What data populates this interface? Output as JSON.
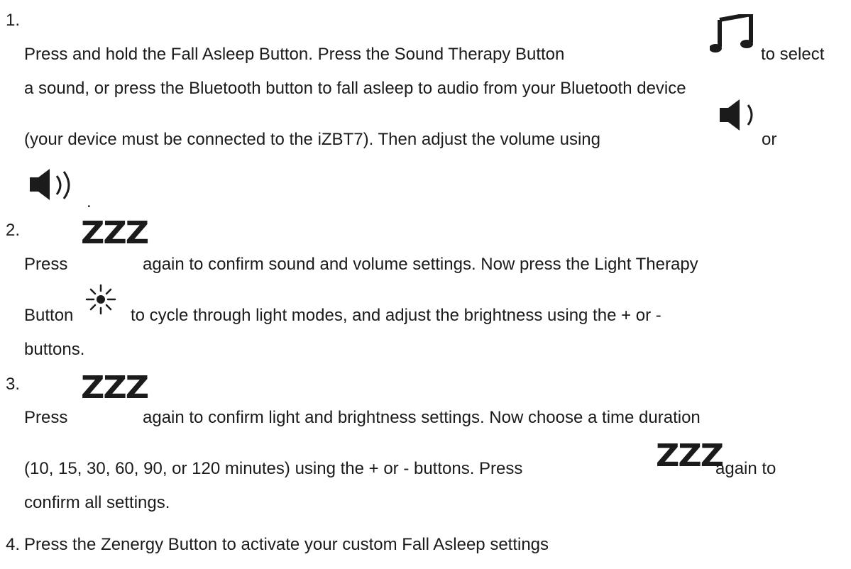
{
  "steps": [
    {
      "number": "1.",
      "lines": [
        "Press and hold the Fall Asleep Button. Press the Sound Therapy Button",
        "to select",
        "a sound, or press the Bluetooth button to fall asleep to audio from your Bluetooth device",
        "(your device must be connected to the iZBT7). Then adjust the volume using",
        "or",
        "."
      ],
      "icons": [
        "music-note-icon",
        "volume-down-icon",
        "volume-up-icon"
      ]
    },
    {
      "number": "2.",
      "lines": [
        "Press",
        "again to confirm sound and volume settings. Now press the Light Therapy",
        "Button",
        "to cycle through light modes, and adjust the brightness using the + or -",
        "buttons."
      ],
      "icons": [
        "fall-asleep-zzz-icon",
        "light-therapy-icon"
      ]
    },
    {
      "number": "3.",
      "lines": [
        "Press",
        "again to confirm light and brightness settings. Now choose a time duration",
        "(10, 15, 30, 60, 90, or 120 minutes) using the + or - buttons. Press",
        "again to",
        "confirm all settings."
      ],
      "icons": [
        "fall-asleep-zzz-icon",
        "fall-asleep-zzz-icon"
      ]
    },
    {
      "number": "4.",
      "lines": [
        "Press the Zenergy Button to activate your custom Fall Asleep settings"
      ]
    }
  ],
  "zzz_glyph": "ZZZ"
}
